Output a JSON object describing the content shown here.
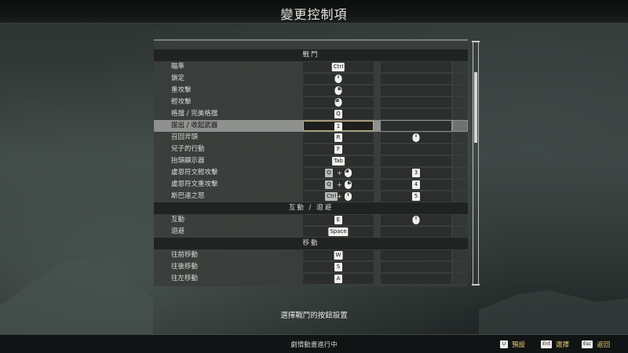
{
  "header": {
    "title": "變更控制項"
  },
  "bindings": [
    {
      "type": "section",
      "label": "戰鬥"
    },
    {
      "type": "item",
      "label": "瞄準",
      "primary": {
        "kind": "key",
        "text": "Ctrl"
      },
      "secondary": null
    },
    {
      "type": "item",
      "label": "鎖定",
      "primary": {
        "kind": "mouse",
        "side": "c"
      },
      "secondary": null
    },
    {
      "type": "item",
      "label": "重攻擊",
      "primary": {
        "kind": "mouse",
        "side": "r"
      },
      "secondary": null
    },
    {
      "type": "item",
      "label": "輕攻擊",
      "primary": {
        "kind": "mouse",
        "side": "l"
      },
      "secondary": null
    },
    {
      "type": "item",
      "label": "格擋 / 完美格擋",
      "primary": {
        "kind": "key",
        "text": "Q"
      },
      "secondary": null
    },
    {
      "type": "item",
      "label": "拔出 / 收起武器",
      "selected": true,
      "primary": {
        "kind": "key",
        "text": "1"
      },
      "secondary": null
    },
    {
      "type": "item",
      "label": "召回斧頭",
      "primary": {
        "kind": "key",
        "text": "R"
      },
      "secondary": {
        "kind": "mouse",
        "side": "c"
      }
    },
    {
      "type": "item",
      "label": "兒子的行動",
      "primary": {
        "kind": "key",
        "text": "F"
      },
      "secondary": null
    },
    {
      "type": "item",
      "label": "抬頭顯示器",
      "primary": {
        "kind": "key",
        "text": "Tab"
      },
      "secondary": null
    },
    {
      "type": "item",
      "label": "盧恩符文輕攻擊",
      "primary": {
        "kind": "combo",
        "text": "Q",
        "side": "l"
      },
      "secondary": {
        "kind": "key",
        "text": "3"
      }
    },
    {
      "type": "item",
      "label": "盧恩符文重攻擊",
      "primary": {
        "kind": "combo",
        "text": "Q",
        "side": "r"
      },
      "secondary": {
        "kind": "key",
        "text": "4"
      }
    },
    {
      "type": "item",
      "label": "斯巴達之怒",
      "primary": {
        "kind": "combo",
        "text": "Ctrl",
        "side": "c"
      },
      "secondary": {
        "kind": "key",
        "text": "5"
      }
    },
    {
      "type": "section",
      "label": "互動 / 迴避"
    },
    {
      "type": "item",
      "label": "互動",
      "primary": {
        "kind": "key",
        "text": "E"
      },
      "secondary": {
        "kind": "mouse",
        "side": "c"
      }
    },
    {
      "type": "item",
      "label": "迴避",
      "primary": {
        "kind": "key",
        "text": "Space"
      },
      "secondary": null
    },
    {
      "type": "section",
      "label": "移動"
    },
    {
      "type": "item",
      "label": "往前移動",
      "primary": {
        "kind": "key",
        "text": "W"
      },
      "secondary": null
    },
    {
      "type": "item",
      "label": "往後移動",
      "primary": {
        "kind": "key",
        "text": "S"
      },
      "secondary": null
    },
    {
      "type": "item",
      "label": "往左移動",
      "primary": {
        "kind": "key",
        "text": "A"
      },
      "secondary": null
    }
  ],
  "hint": "選擇戰鬥的按鈕設置",
  "footer": {
    "status": "劇情動畫進行中",
    "prompts": [
      {
        "key": "U",
        "label": "預設"
      },
      {
        "key": "Ent",
        "label": "選擇"
      },
      {
        "key": "Esc",
        "label": "返回"
      }
    ]
  },
  "colors": {
    "accent": "#e9c96a",
    "selection": "#c5ad6a",
    "panel": "#3a3e3c"
  }
}
